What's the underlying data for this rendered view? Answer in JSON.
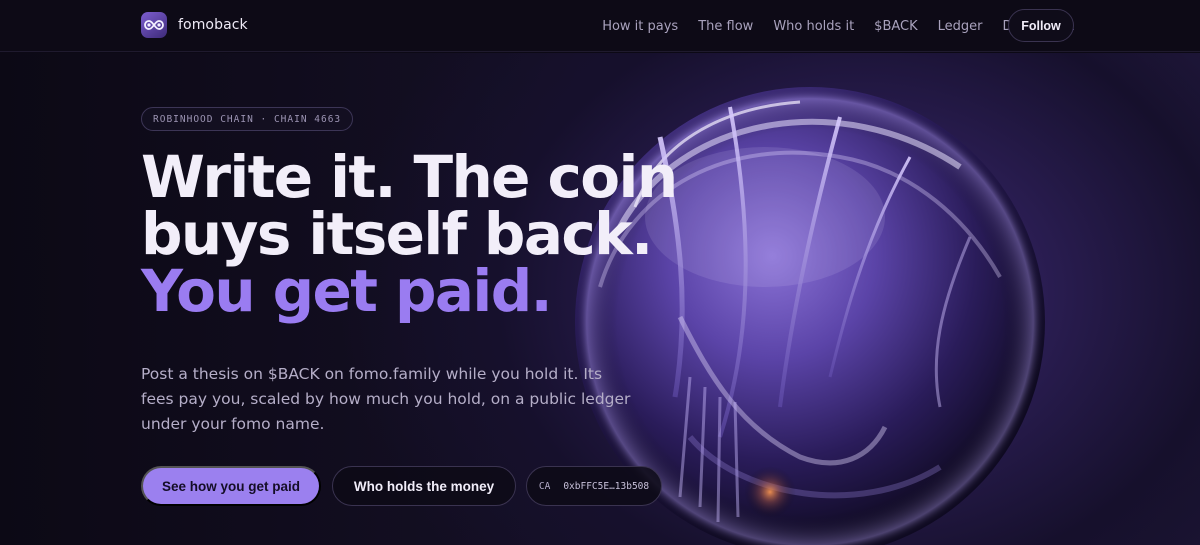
{
  "nav": {
    "brand": "fomoback",
    "links": [
      "How it pays",
      "The flow",
      "Who holds it",
      "$BACK",
      "Ledger",
      "Docs"
    ],
    "ca_label": "CA",
    "follow_label": "Follow"
  },
  "hero": {
    "badge": "ROBINHOOD CHAIN · CHAIN 4663",
    "headline_line1": "Write it. The coin",
    "headline_line2": "buys itself back.",
    "headline_accent": "You get paid.",
    "lede": "Post a thesis on $BACK on fomo.family while you hold it. Its fees pay you, scaled by how much you hold, on a public ledger under your fomo name.",
    "cta_primary": "See how you get paid",
    "cta_secondary": "Who holds the money",
    "ca_chip_label": "CA",
    "ca_chip_value": "0xbFFC5E…13b508"
  },
  "icons": {
    "logo": "fomoback-logo-icon",
    "hero_art": "chrome-sphere-illustration"
  },
  "colors": {
    "background": "#0c0915",
    "accent": "#9a7cf1",
    "primary_button": "#9b80ef"
  }
}
